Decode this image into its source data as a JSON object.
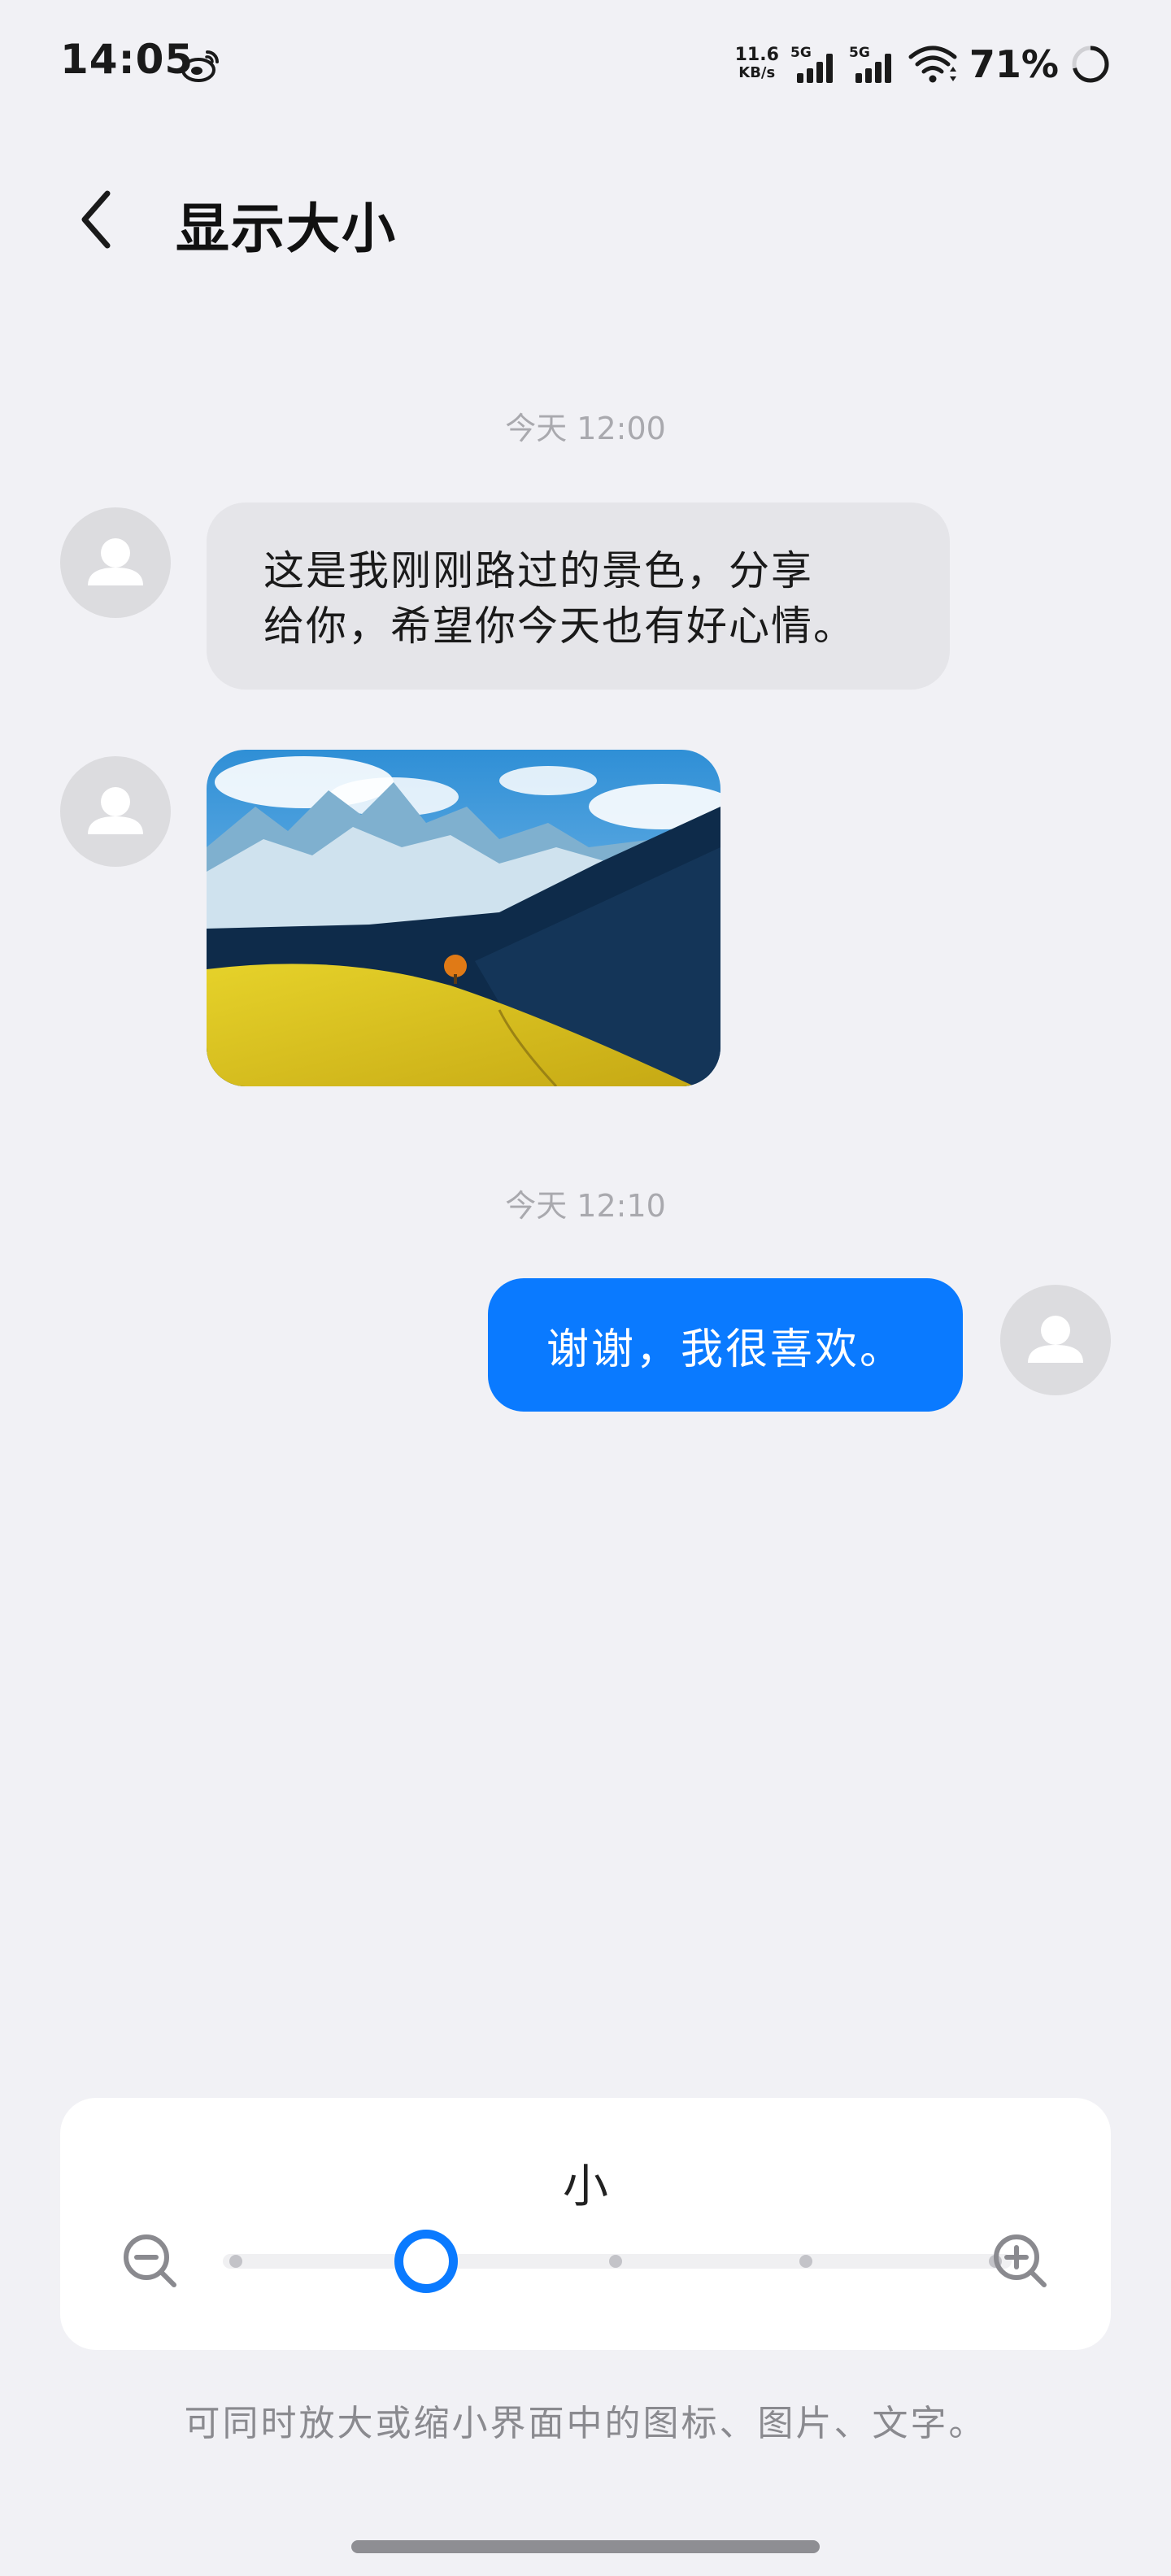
{
  "status_bar": {
    "time": "14:05",
    "net_speed": "11.6",
    "net_unit": "KB/s",
    "sim1": "5G",
    "sim2": "5G",
    "battery": "71%",
    "battery_level": 0.71,
    "icons": [
      "weibo-icon",
      "signal-icon",
      "wifi-icon",
      "battery-ring-icon"
    ]
  },
  "header": {
    "title": "显示大小",
    "back_icon": "chevron-left-icon"
  },
  "chat": {
    "timestamp_1": "今天 12:00",
    "message_in_line1": "这是我刚刚路过的景色，分享",
    "message_in_line2": "给你，希望你今天也有好心情。",
    "timestamp_2": "今天 12:10",
    "message_out": "谢谢，我很喜欢。"
  },
  "size_control": {
    "current_label": "小",
    "levels": 5,
    "selected_index": 1,
    "zoom_out_icon": "zoom-out-icon",
    "zoom_in_icon": "zoom-in-icon",
    "accent_color": "#0a7aff"
  },
  "hint": "可同时放大或缩小界面中的图标、图片、文字。"
}
